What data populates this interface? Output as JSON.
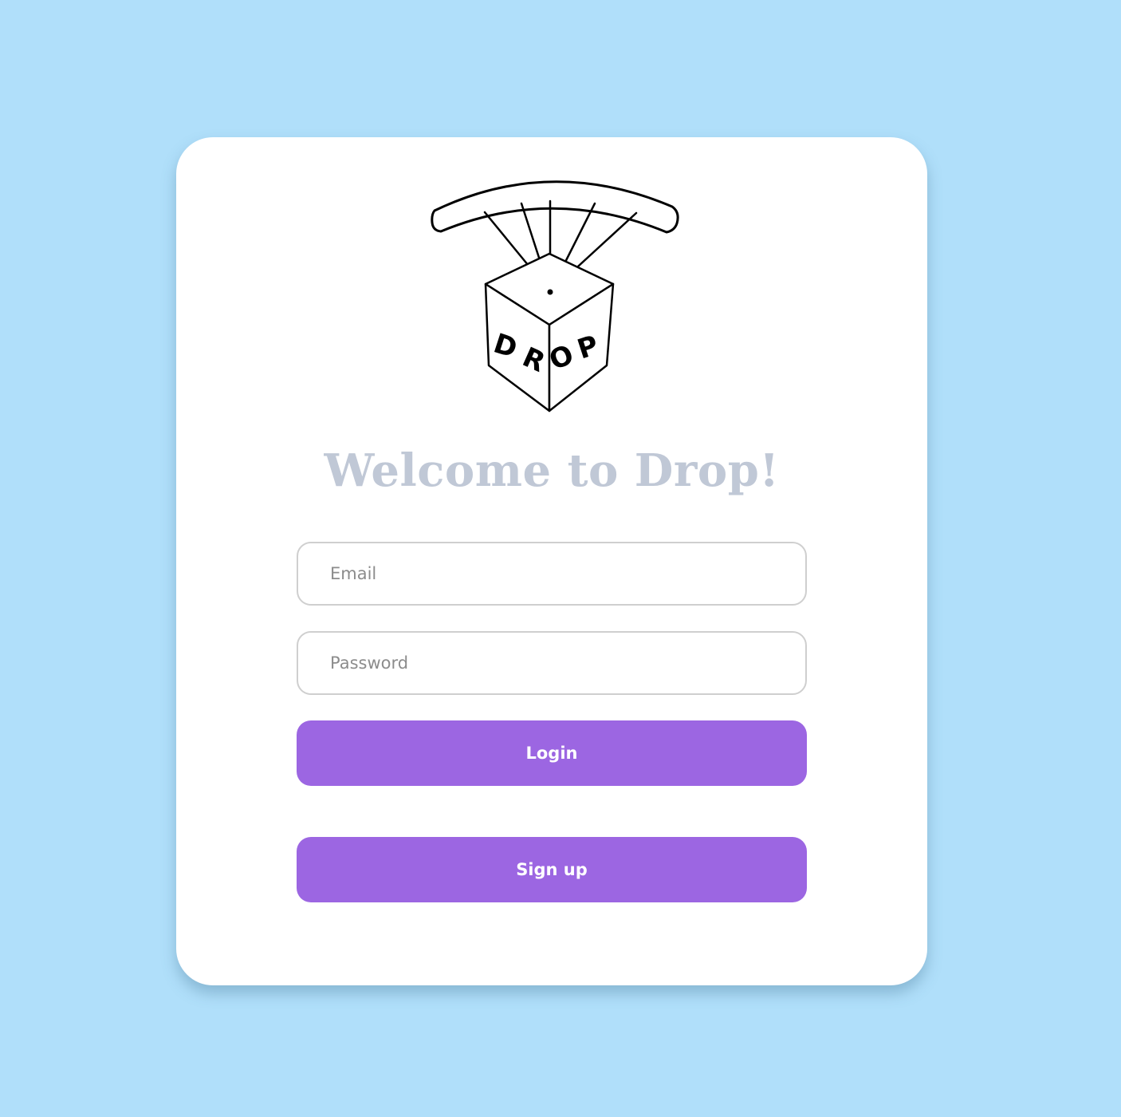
{
  "logo": {
    "name": "drop-parachute-box-logo",
    "letters": [
      "D",
      "R",
      "O",
      "P"
    ]
  },
  "heading": {
    "title": "Welcome to Drop!"
  },
  "form": {
    "email_placeholder": "Email",
    "password_placeholder": "Password",
    "login_label": "Login",
    "signup_label": "Sign up"
  },
  "colors": {
    "background": "#b0dffa",
    "card": "#ffffff",
    "title": "#c0c8d6",
    "button": "#9c66e2",
    "button_text": "#ffffff",
    "field_border": "#cfcfcf",
    "placeholder": "#8c8c8c"
  }
}
